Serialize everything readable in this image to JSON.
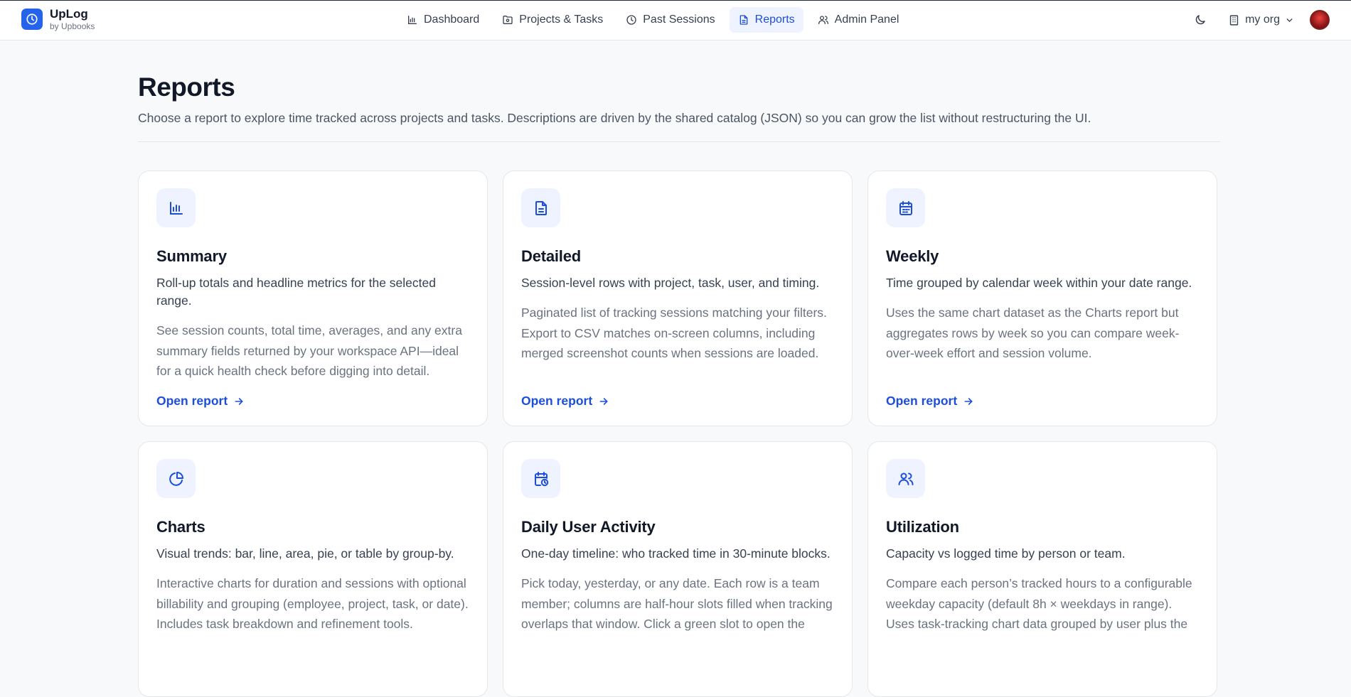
{
  "brand": {
    "name": "UpLog",
    "sub": "by Upbooks"
  },
  "nav": [
    {
      "label": "Dashboard",
      "icon": "bar-chart-icon"
    },
    {
      "label": "Projects & Tasks",
      "icon": "folder-icon"
    },
    {
      "label": "Past Sessions",
      "icon": "clock-icon"
    },
    {
      "label": "Reports",
      "icon": "file-text-icon",
      "active": true
    },
    {
      "label": "Admin Panel",
      "icon": "users-icon"
    }
  ],
  "header_tools": {
    "theme_icon": "moon-icon",
    "org_icon": "building-icon",
    "org_label": "my org"
  },
  "page": {
    "title": "Reports",
    "description": "Choose a report to explore time tracked across projects and tasks. Descriptions are driven by the shared catalog (JSON) so you can grow the list without restructuring the UI."
  },
  "link_label": "Open report",
  "cards": [
    {
      "title": "Summary",
      "icon": "bar-chart-icon",
      "summary": "Roll-up totals and headline metrics for the selected range.",
      "detail": "See session counts, total time, averages, and any extra summary fields returned by your workspace API—ideal for a quick health check before digging into detail."
    },
    {
      "title": "Detailed",
      "icon": "file-text-icon",
      "summary": "Session-level rows with project, task, user, and timing.",
      "detail": "Paginated list of tracking sessions matching your filters. Export to CSV matches on-screen columns, including merged screenshot counts when sessions are loaded."
    },
    {
      "title": "Weekly",
      "icon": "calendar-icon",
      "summary": "Time grouped by calendar week within your date range.",
      "detail": "Uses the same chart dataset as the Charts report but aggregates rows by week so you can compare week-over-week effort and session volume."
    },
    {
      "title": "Charts",
      "icon": "pie-chart-icon",
      "summary": "Visual trends: bar, line, area, pie, or table by group-by.",
      "detail": "Interactive charts for duration and sessions with optional billability and grouping (employee, project, task, or date). Includes task breakdown and refinement tools."
    },
    {
      "title": "Daily User Activity",
      "icon": "calendar-clock-icon",
      "summary": "One-day timeline: who tracked time in 30-minute blocks.",
      "detail": "Pick today, yesterday, or any date. Each row is a team member; columns are half-hour slots filled when tracking overlaps that window. Click a green slot to open the"
    },
    {
      "title": "Utilization",
      "icon": "users-icon",
      "summary": "Capacity vs logged time by person or team.",
      "detail": "Compare each person’s tracked hours to a configurable weekday capacity (default 8h × weekdays in range). Uses task-tracking chart data grouped by user plus the"
    }
  ],
  "colors": {
    "accent": "#2563eb",
    "accent_dark": "#1d4ed8",
    "active_bg": "#eef3ff",
    "page_bg": "#f8f9fb"
  }
}
